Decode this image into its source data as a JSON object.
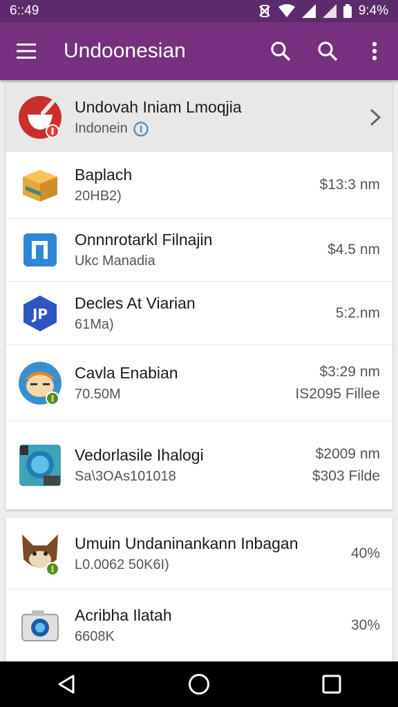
{
  "status_bar": {
    "time": "6::49",
    "battery": "9:4%"
  },
  "app_bar": {
    "title": "Undoonesian",
    "menu_icon": "hamburger-menu-icon",
    "actions": [
      "search-icon",
      "search-icon",
      "more-vert-icon"
    ]
  },
  "header_item": {
    "title": "Undovah Iniam Lmoqjia",
    "subtitle": "Indonein",
    "icon": "mortar-pestle-app-icon",
    "badge_icon": "info-icon",
    "chevron_icon": "chevron-right-icon"
  },
  "list_items": [
    {
      "title": "Baplach",
      "subtitle": "20HB2)",
      "meta1": "$13:3 nm",
      "meta2": "",
      "icon": "box-app-icon"
    },
    {
      "title": "Onnnrotarkl Filnajin",
      "subtitle": "Ukc Manadia",
      "meta1": "$4.5 nm",
      "meta2": "",
      "icon": "blue-square-app-icon"
    },
    {
      "title": "Decles At Viarian",
      "subtitle": "61Ma)",
      "meta1": "5:2.nm",
      "meta2": "",
      "icon": "hexagon-app-icon"
    },
    {
      "title": "Cavla Enabian",
      "subtitle": "70.50M",
      "meta1": "$3:29 nm",
      "meta2": "IS2095 Fillee",
      "icon": "character-app-icon"
    },
    {
      "title": "Vedorlasile Ihalogi",
      "subtitle": "Sa\\3OAs101018",
      "meta1": "$2009 nm",
      "meta2": "$303 Filde",
      "icon": "teal-lens-app-icon"
    }
  ],
  "second_items": [
    {
      "title": "Umuin Undaninankann Inbagan",
      "subtitle": "L0.0062 50K6I)",
      "meta1": "40%",
      "icon": "fox-app-icon"
    },
    {
      "title": "Acribha Ilatah",
      "subtitle": "6608K",
      "meta1": "30%",
      "icon": "camera-app-icon"
    }
  ],
  "nav_bar": {
    "buttons": [
      "back-icon",
      "home-icon",
      "recents-icon"
    ]
  },
  "colors": {
    "status_bar": "#5e2a6e",
    "app_bar": "#76307f"
  }
}
